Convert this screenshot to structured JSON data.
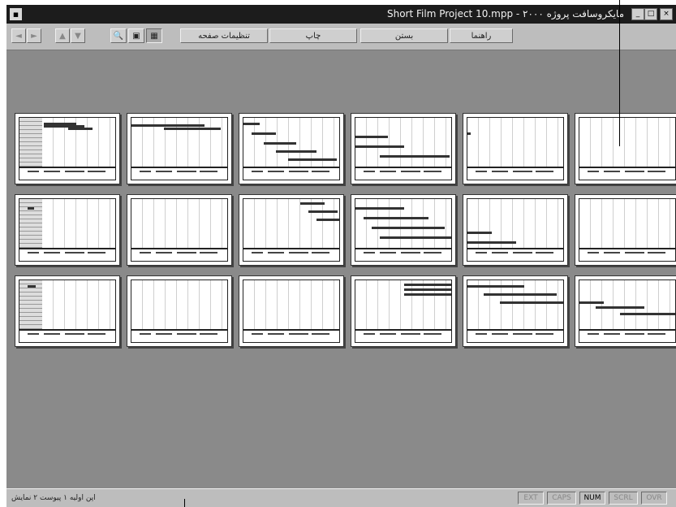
{
  "window": {
    "title": "Short Film Project 10.mpp - ۲۰۰۰ مایکروسافت پروژه",
    "buttons": {
      "minimize": "_",
      "maximize": "□",
      "close": "×"
    }
  },
  "toolbar": {
    "nav": [
      {
        "name": "first-page-button",
        "label": "◄"
      },
      {
        "name": "next-page-button",
        "label": "►"
      },
      {
        "name": "up-page-button",
        "label": "▲"
      },
      {
        "name": "down-page-button",
        "label": "▼"
      }
    ],
    "view": [
      {
        "name": "zoom-button",
        "label": "🔍"
      },
      {
        "name": "one-page-button",
        "label": "▣"
      },
      {
        "name": "multiple-pages-button",
        "label": "▦"
      }
    ],
    "page_setup_label": "تنظیمات صفحه",
    "print_label": "چاپ",
    "close_label": "بستن",
    "help_label": "راهنما"
  },
  "pages": {
    "count": 18
  },
  "status": {
    "left_text": "اپن اولیه ۱ پیوست ۲ نمایش",
    "indicators": [
      "EXT",
      "CAPS",
      "NUM",
      "SCRL",
      "OVR"
    ],
    "active_indicator": "NUM"
  }
}
